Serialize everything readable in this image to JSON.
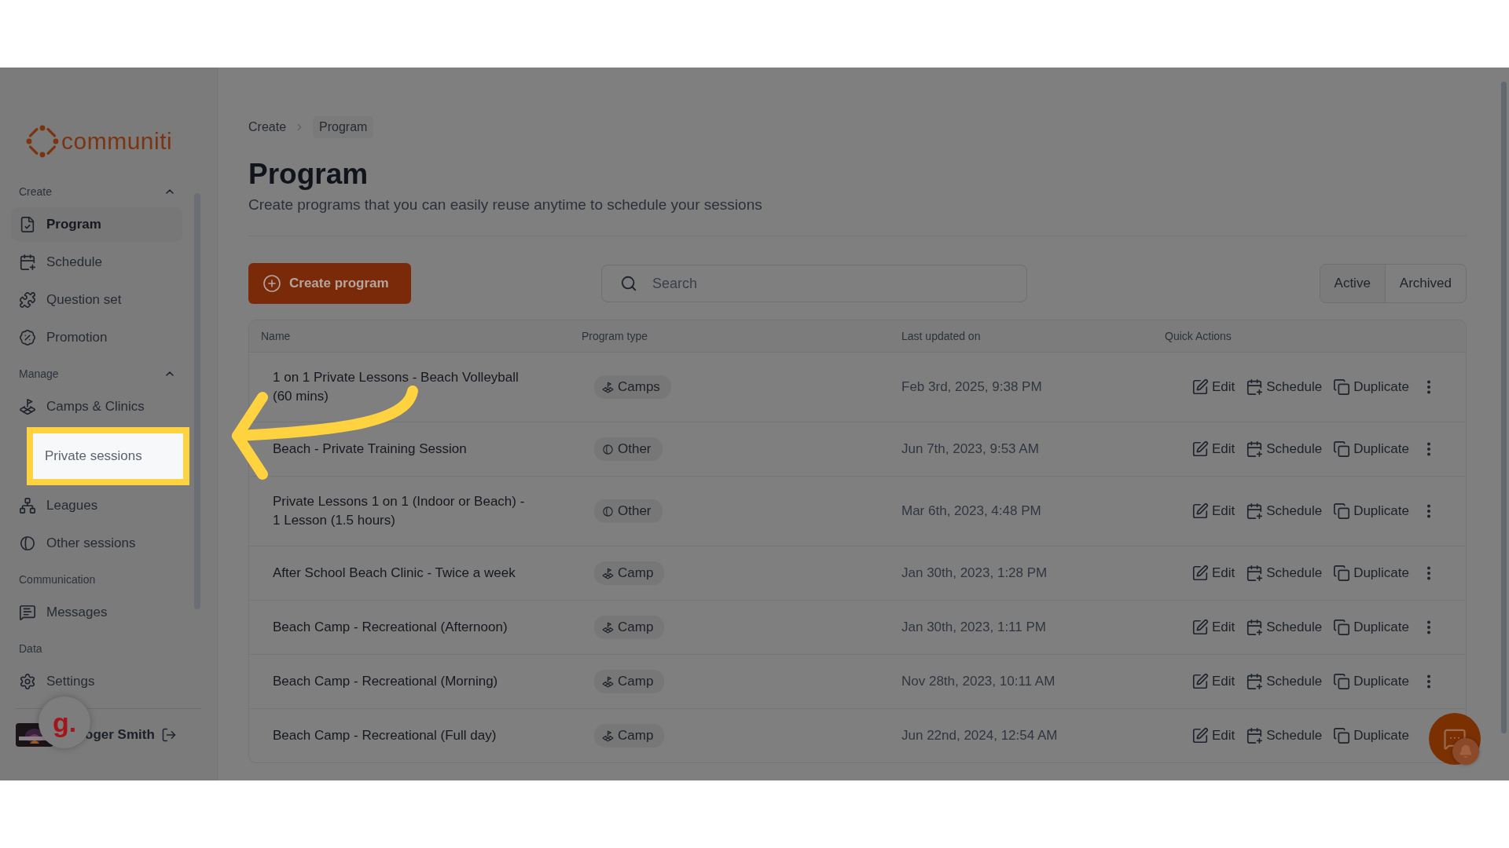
{
  "logo": {
    "text": "communiti"
  },
  "sidebar": {
    "sections": [
      {
        "title": "Create",
        "collapsible": true,
        "items": [
          {
            "label": "Program",
            "selected": true,
            "spotlight": false
          },
          {
            "label": "Schedule",
            "selected": false,
            "spotlight": false
          },
          {
            "label": "Question set",
            "selected": false,
            "spotlight": false
          },
          {
            "label": "Promotion",
            "selected": false,
            "spotlight": false
          }
        ]
      },
      {
        "title": "Manage",
        "collapsible": true,
        "items": [
          {
            "label": "Camps & Clinics",
            "selected": false,
            "spotlight": false
          },
          {
            "label": "Private sessions",
            "selected": false,
            "spotlight": true
          },
          {
            "label": "Leagues",
            "selected": false,
            "spotlight": false
          },
          {
            "label": "Other sessions",
            "selected": false,
            "spotlight": false
          }
        ]
      },
      {
        "title": "Communication",
        "collapsible": false,
        "items": [
          {
            "label": "Messages",
            "selected": false,
            "spotlight": false
          }
        ]
      },
      {
        "title": "Data",
        "collapsible": false,
        "items": [
          {
            "label": "Settings",
            "selected": false,
            "spotlight": false
          }
        ]
      }
    ],
    "user": {
      "name": "oger Smith"
    }
  },
  "assistant_badge": {
    "text": "g."
  },
  "breadcrumb": [
    "Create",
    "Program"
  ],
  "page": {
    "title": "Program",
    "subtitle": "Create programs that you can easily reuse anytime to schedule your sessions"
  },
  "create_button": {
    "label": "Create program"
  },
  "search": {
    "placeholder": "Search"
  },
  "tabs": [
    {
      "label": "Active",
      "selected": true
    },
    {
      "label": "Archived",
      "selected": false
    }
  ],
  "table": {
    "columns": [
      "Name",
      "Program type",
      "Last updated on",
      "Quick Actions"
    ],
    "rows": [
      {
        "name": "1 on 1 Private Lessons - Beach Volleyball (60 mins)",
        "type": {
          "label": "Camps",
          "kind": "camp"
        },
        "updated": "Feb 3rd, 2025, 9:38 PM",
        "actions": [
          "Edit",
          "Schedule",
          "Duplicate"
        ],
        "more": true
      },
      {
        "name": "Beach - Private Training Session",
        "type": {
          "label": "Other",
          "kind": "other"
        },
        "updated": "Jun 7th, 2023, 9:53 AM",
        "actions": [
          "Edit",
          "Schedule",
          "Duplicate"
        ],
        "more": true
      },
      {
        "name": "Private Lessons 1 on 1 (Indoor or Beach) - 1 Lesson (1.5 hours)",
        "type": {
          "label": "Other",
          "kind": "other"
        },
        "updated": "Mar 6th, 2023, 4:48 PM",
        "actions": [
          "Edit",
          "Schedule",
          "Duplicate"
        ],
        "more": true
      },
      {
        "name": "After School Beach Clinic - Twice a week",
        "type": {
          "label": "Camp",
          "kind": "camp"
        },
        "updated": "Jan 30th, 2023, 1:28 PM",
        "actions": [
          "Edit",
          "Schedule",
          "Duplicate"
        ],
        "more": true
      },
      {
        "name": "Beach Camp - Recreational (Afternoon)",
        "type": {
          "label": "Camp",
          "kind": "camp"
        },
        "updated": "Jan 30th, 2023, 1:11 PM",
        "actions": [
          "Edit",
          "Schedule",
          "Duplicate"
        ],
        "more": true
      },
      {
        "name": "Beach Camp - Recreational (Morning)",
        "type": {
          "label": "Camp",
          "kind": "camp"
        },
        "updated": "Nov 28th, 2023, 10:11 AM",
        "actions": [
          "Edit",
          "Schedule",
          "Duplicate"
        ],
        "more": true
      },
      {
        "name": "Beach Camp - Recreational (Full day)",
        "type": {
          "label": "Camp",
          "kind": "camp"
        },
        "updated": "Jun 22nd, 2024, 12:54 AM",
        "actions": [
          "Edit",
          "Schedule",
          "Duplicate"
        ],
        "more": false
      }
    ]
  }
}
